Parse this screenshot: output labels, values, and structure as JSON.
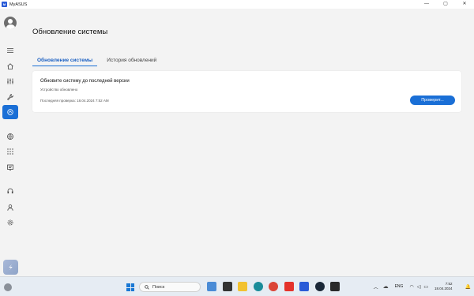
{
  "window": {
    "title": "MyASUS",
    "logo_text": "M",
    "controls": {
      "minimize": "—",
      "maximize": "▢",
      "close": "✕"
    }
  },
  "sidebar": {
    "items": [
      {
        "name": "menu",
        "icon": "hamburger-icon"
      },
      {
        "name": "home",
        "icon": "home-icon"
      },
      {
        "name": "customization",
        "icon": "sliders-icon"
      },
      {
        "name": "diagnostics",
        "icon": "wrench-icon"
      },
      {
        "name": "system-update",
        "icon": "update-icon",
        "active": true
      },
      {
        "name": "link-to-myasus",
        "icon": "globe-icon"
      },
      {
        "name": "app-deals",
        "icon": "apps-grid-icon"
      },
      {
        "name": "news",
        "icon": "news-icon"
      },
      {
        "name": "support",
        "icon": "headset-icon"
      },
      {
        "name": "user-center",
        "icon": "user-icon"
      },
      {
        "name": "settings",
        "icon": "gear-icon"
      }
    ],
    "bottom_icon": "storeapp-icon"
  },
  "main": {
    "title": "Обновление системы",
    "tabs": [
      {
        "label": "Обновление системы",
        "active": true
      },
      {
        "label": "История обновлений",
        "active": false
      }
    ],
    "card": {
      "heading": "Обновите систему до последней версии",
      "status": "Устройство обновлено",
      "last_check": "Последняя проверка: 18.04.2024 7:52 AM",
      "button_label": "Проверит..."
    }
  },
  "taskbar": {
    "search_placeholder": "Поиск",
    "apps": [
      {
        "icon": "widgets-icon",
        "color": "#4a8bd6"
      },
      {
        "icon": "media-player-icon",
        "color": "#333333"
      },
      {
        "icon": "file-explorer-icon",
        "color": "#f2c230"
      },
      {
        "icon": "edge-icon",
        "color": "#1a8c9a"
      },
      {
        "icon": "chrome-icon",
        "color": "#db4437"
      },
      {
        "icon": "yandex-icon",
        "color": "#e4322b"
      },
      {
        "icon": "myasus-icon",
        "color": "#2a5bd7"
      },
      {
        "icon": "steam-icon",
        "color": "#1b2838"
      },
      {
        "icon": "epic-games-icon",
        "color": "#2a2a2a"
      }
    ],
    "tray": {
      "language": "ENG",
      "time": "7:52",
      "date": "18.04.2024"
    }
  },
  "colors": {
    "accent": "#1a6fd6",
    "background": "#f3f3f3",
    "card": "#ffffff"
  }
}
